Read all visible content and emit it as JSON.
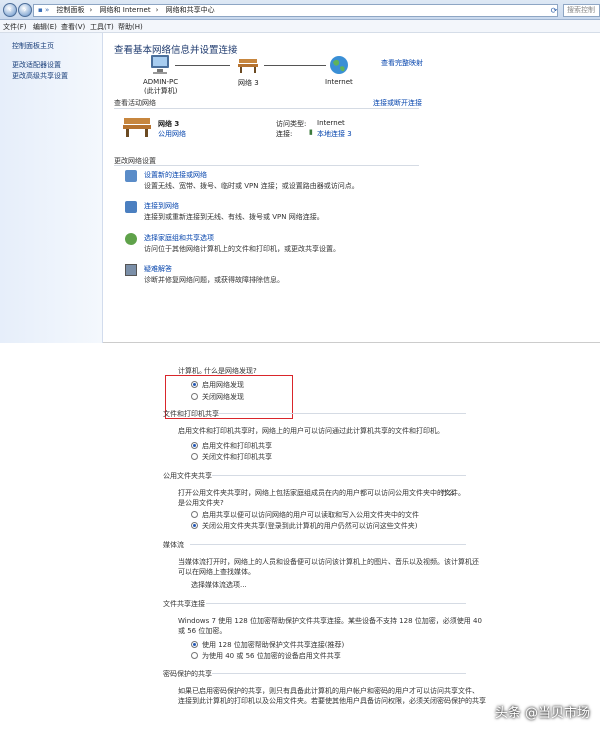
{
  "address_bar": {
    "breadcrumbs": [
      "控制面板",
      "网络和 Internet",
      "网络和共享中心"
    ],
    "search_placeholder": "搜索控制"
  },
  "menu": [
    "文件(F)",
    "编辑(E)",
    "查看(V)",
    "工具(T)",
    "帮助(H)"
  ],
  "sidebar": [
    "控制面板主页",
    "更改适配器设置",
    "更改高级共享设置"
  ],
  "page_title": "查看基本网络信息并设置连接",
  "map": {
    "full_map_link": "查看完整映射",
    "computer": "ADMIN-PC",
    "computer_sub": "(此计算机)",
    "network": "网络  3",
    "internet": "Internet"
  },
  "active": {
    "header": "查看活动网络",
    "connect_link": "连接或断开连接",
    "name": "网络  3",
    "type": "公用网络",
    "access_label": "访问类型:",
    "access_value": "Internet",
    "conn_label": "连接:",
    "conn_value": "本地连接 3"
  },
  "settings": {
    "header": "更改网络设置",
    "tasks": [
      {
        "link": "设置新的连接或网络",
        "desc": "设置无线、宽带、拨号、临时或 VPN 连接；或设置路由器或访问点。"
      },
      {
        "link": "连接到网络",
        "desc": "连接到或重新连接到无线、有线、拨号或 VPN 网络连接。"
      },
      {
        "link": "选择家庭组和共享选项",
        "desc": "访问位于其他网络计算机上的文件和打印机，或更改共享设置。"
      },
      {
        "link": "疑难解答",
        "desc": "诊断并修复网络问题，或获得故障排除信息。"
      }
    ]
  },
  "discovery": {
    "intro": "计算机。",
    "intro_link": "什么是网络发现?",
    "on": "启用网络发现",
    "off": "关闭网络发现",
    "selected": 0
  },
  "file_print": {
    "header": "文件和打印机共享",
    "desc": "启用文件和打印机共享时，网络上的用户可以访问通过此计算机共享的文件和打印机。",
    "on": "启用文件和打印机共享",
    "off": "关闭文件和打印机共享",
    "selected": 0
  },
  "public_folder": {
    "header": "公用文件夹共享",
    "desc1": "打开公用文件夹共享时，网络上包括家庭组成员在内的用户都可以访问公用文件夹中的文件。",
    "desc_link1": "什么",
    "desc_link2": "是公用文件夹?",
    "on": "启用共享以便可以访问网络的用户可以读取和写入公用文件夹中的文件",
    "off": "关闭公用文件夹共享(登录到此计算机的用户仍然可以访问这些文件夹)",
    "selected": 1
  },
  "media": {
    "header": "媒体流",
    "desc1": "当媒体流打开时，网络上的人员和设备便可以访问该计算机上的图片、音乐以及视频。该计算机还",
    "desc2": "可以在网络上查找媒体。",
    "link": "选择媒体流选项..."
  },
  "file_sharing_conn": {
    "header": "文件共享连接",
    "desc1": "Windows 7 使用 128 位加密帮助保护文件共享连接。某些设备不支持 128 位加密，必须使用 40",
    "desc2": "或 56 位加密。",
    "opt1": "使用 128 位加密帮助保护文件共享连接(推荐)",
    "opt2": "为使用 40 或 56 位加密的设备启用文件共享",
    "selected": 0
  },
  "password": {
    "header": "密码保护的共享",
    "desc1": "如果已启用密码保护的共享，则只有具备此计算机的用户帐户和密码的用户才可以访问共享文件、",
    "desc2": "连接到此计算机的打印机以及公用文件夹。若要使其他用户具备访问权限，必须关闭密码保护的共享"
  },
  "watermark": "头条 @当贝市场"
}
